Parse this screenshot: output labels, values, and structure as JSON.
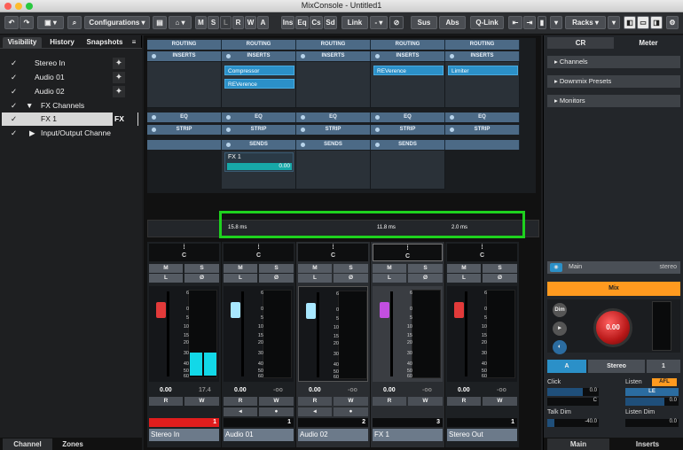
{
  "window": {
    "title": "MixConsole - Untitled1"
  },
  "toolbar": {
    "configurations": "Configurations",
    "solo_buttons": [
      "M",
      "S",
      "L",
      "R",
      "W",
      "A"
    ],
    "view_buttons": [
      "Ins",
      "Eq",
      "Cs",
      "Sd"
    ],
    "link": "Link",
    "sus": "Sus",
    "abs": "Abs",
    "qlink": "Q-Link",
    "racks": "Racks"
  },
  "left_panel": {
    "tabs": [
      "Visibility",
      "History",
      "Snapshots"
    ],
    "items": [
      {
        "label": "Stereo In",
        "checked": true
      },
      {
        "label": "Audio 01",
        "checked": true
      },
      {
        "label": "Audio 02",
        "checked": true
      },
      {
        "label": "FX Channels",
        "checked": true
      },
      {
        "label": "FX 1",
        "checked": true,
        "fx_tag": "FX"
      },
      {
        "label": "Input/Output Channe",
        "checked": true
      }
    ],
    "bottom_tabs": [
      "Channel",
      "Zones"
    ]
  },
  "racks": {
    "routing": "ROUTING",
    "inserts": "INSERTS",
    "eq": "EQ",
    "strip": "STRIP",
    "sends": "SENDS",
    "plugins": [
      "Compressor",
      "REVerence",
      "REVerence",
      "Limiter"
    ],
    "send": {
      "name": "FX 1",
      "level": "0.00"
    }
  },
  "latency": [
    "15.8 ms",
    "11.8 ms",
    "2.0 ms"
  ],
  "channels": [
    {
      "name": "Stereo In",
      "number": "1",
      "value": "0.00",
      "peak": "17.4",
      "pan": "C",
      "color": "#e23a3a"
    },
    {
      "name": "Audio 01",
      "number": "1",
      "value": "0.00",
      "peak": "-oo",
      "pan": "C",
      "color": "#a8e8ff"
    },
    {
      "name": "Audio 02",
      "number": "2",
      "value": "0.00",
      "peak": "-oo",
      "pan": "C",
      "color": "#a8e8ff"
    },
    {
      "name": "FX 1",
      "number": "3",
      "value": "0.00",
      "peak": "-oo",
      "pan": "C",
      "color": "#c24fe0"
    },
    {
      "name": "Stereo Out",
      "number": "1",
      "value": "0.00",
      "peak": "-oo",
      "pan": "C",
      "color": "#e23a3a"
    }
  ],
  "scale": [
    "6",
    "0",
    "5",
    "10",
    "15",
    "20",
    "30",
    "40",
    "50",
    "60"
  ],
  "strip_buttons": {
    "m": "M",
    "s": "S",
    "l": "L",
    "phase": "Ø",
    "r": "R",
    "w": "W"
  },
  "right_panel": {
    "tabs": [
      "CR",
      "Meter"
    ],
    "sections": [
      "Channels",
      "Downmix Presets",
      "Monitors"
    ],
    "main_label": "Main",
    "main_format": "stereo",
    "mix": "Mix",
    "dim": "Dim",
    "knob_value": "0.00",
    "a_btn": "A",
    "stereo_btn": "Stereo",
    "one_btn": "1",
    "click": "Click",
    "click_val": "0.0",
    "click_c": "C",
    "listen": "Listen",
    "afl": "AFL",
    "le": "LE",
    "listen_val": "0.0",
    "talk_dim": "Talk Dim",
    "talk_val": "-40.0",
    "listen_dim": "Listen Dim",
    "listen_dim_val": "0.0",
    "bottom_tabs": [
      "Main",
      "Inserts"
    ]
  },
  "colors": {
    "accent_orange": "#ff9a1f",
    "green_highlight": "#1ed21e",
    "plugin_blue": "#2b90c8"
  }
}
